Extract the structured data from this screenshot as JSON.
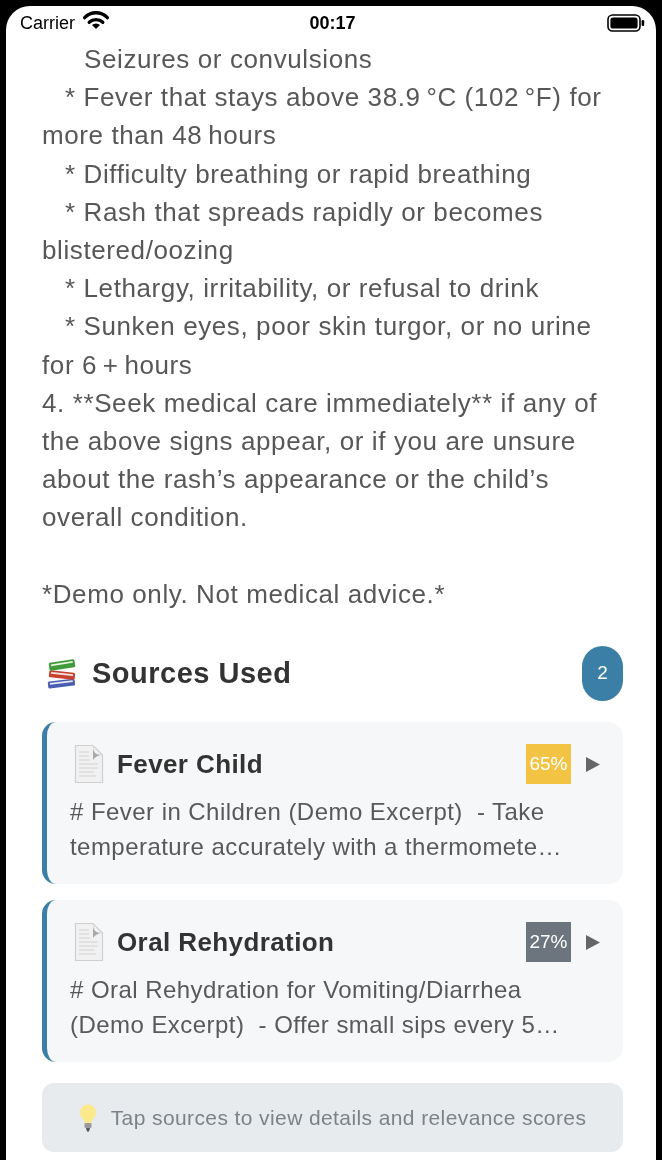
{
  "status_bar": {
    "carrier": "Carrier",
    "time": "00:17"
  },
  "answer": {
    "lines": [
      {
        "kind": "covered",
        "text": "Seizures or convulsions"
      },
      {
        "kind": "bullet",
        "text": "* Fever that stays above 38.9 °C (102 °F) for more than 48 hours"
      },
      {
        "kind": "bullet",
        "text": "* Difficulty breathing or rapid breathing"
      },
      {
        "kind": "bullet",
        "text": "* Rash that spreads rapidly or becomes blistered/oozing"
      },
      {
        "kind": "bullet",
        "text": "* Lethargy, irritability, or refusal to drink"
      },
      {
        "kind": "bullet",
        "text": "* Sunken eyes, poor skin turgor, or no urine for 6 + hours"
      },
      {
        "kind": "numbered",
        "text": "4. **Seek medical care immediately** if any of the above signs appear, or if you are unsure about the rash’s appearance or the child’s overall condition."
      },
      {
        "kind": "note",
        "text": "*Demo only. Not medical advice.*"
      }
    ]
  },
  "sources": {
    "title": "Sources Used",
    "count": "2",
    "items": [
      {
        "title": "Fever Child",
        "score": "65%",
        "color": "#f3c443",
        "expanded": false,
        "excerpt": "# Fever in Children (Demo Excerpt)  - Take temperature accurately with a thermomete…"
      },
      {
        "title": "Oral Rehydration",
        "score": "27%",
        "color": "#6c757d",
        "expanded": false,
        "excerpt": "# Oral Rehydration for Vomiting/Diarrhea (Demo Excerpt)  - Offer small sips every 5…"
      }
    ]
  },
  "tip": {
    "text": "Tap sources to view details and relevance scores"
  }
}
